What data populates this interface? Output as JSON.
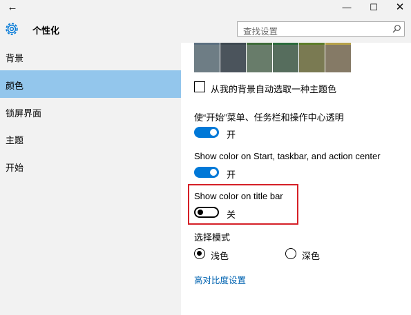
{
  "window": {
    "back_glyph": "←",
    "minimize_glyph": "—",
    "maximize_glyph": "☐",
    "close_glyph": "✕"
  },
  "header": {
    "title": "个性化",
    "search_placeholder": "查找设置"
  },
  "sidebar": {
    "items": [
      {
        "label": "背景",
        "active": false
      },
      {
        "label": "颜色",
        "active": true
      },
      {
        "label": "锁屏界面",
        "active": false
      },
      {
        "label": "主题",
        "active": false
      },
      {
        "label": "开始",
        "active": false
      }
    ]
  },
  "colors": {
    "accent": "#0078d7",
    "active_nav": "#93c6ec",
    "highlight_border": "#d51f26",
    "link": "#0063b1",
    "top_swatches": [
      "#5c7080",
      "#3f4a52",
      "#3f6b3a",
      "#2b6b3c",
      "#5e7d2a",
      "#b7a24a"
    ],
    "swatches": [
      "#6e7d85",
      "#4b545c",
      "#687c6a",
      "#566d5d",
      "#7a7a52",
      "#857a66"
    ]
  },
  "content": {
    "auto_pick": {
      "label": "从我的背景自动选取一种主题色",
      "checked": false
    },
    "transparency": {
      "label": "使“开始”菜单、任务栏和操作中心透明",
      "state": "开",
      "on": true
    },
    "show_color_start": {
      "label": "Show color on Start, taskbar, and action center",
      "state": "开",
      "on": true
    },
    "show_color_title": {
      "label": "Show color on title bar",
      "state": "关",
      "on": false
    },
    "mode": {
      "label": "选择模式",
      "options": [
        {
          "label": "浅色",
          "checked": true
        },
        {
          "label": "深色",
          "checked": false
        }
      ]
    },
    "high_contrast_link": "高对比度设置"
  }
}
